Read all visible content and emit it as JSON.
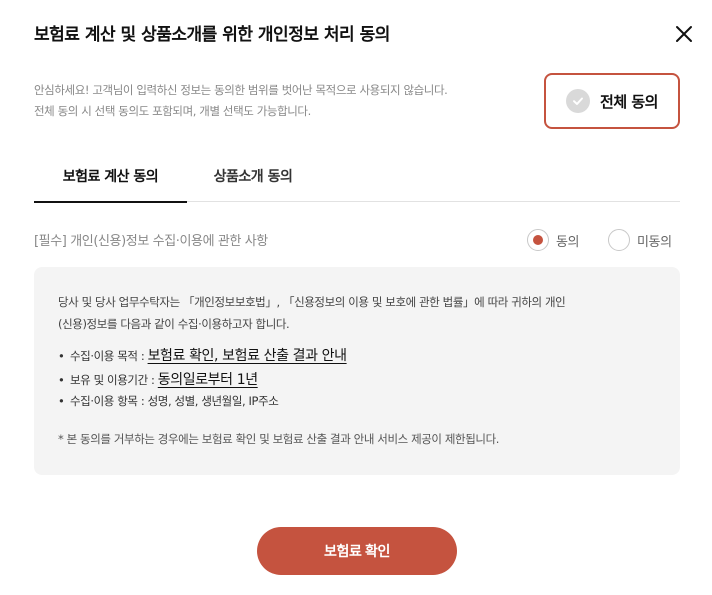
{
  "modal": {
    "title": "보험료 계산 및 상품소개를 위한 개인정보 처리 동의",
    "intro_line1": "안심하세요! 고객님이 입력하신 정보는 동의한 범위를 벗어난 목적으로 사용되지 않습니다.",
    "intro_line2": "전체 동의 시 선택 동의도 포함되며, 개별 선택도 가능합니다.",
    "agree_all_label": "전체 동의"
  },
  "tabs": [
    {
      "label": "보험료 계산 동의",
      "active": true
    },
    {
      "label": "상품소개 동의",
      "active": false
    }
  ],
  "consent": {
    "section_label": "[필수] 개인(신용)정보 수집·이용에 관한 사항",
    "agree_label": "동의",
    "disagree_label": "미동의",
    "selected": "agree"
  },
  "details": {
    "paragraph_line1": "당사 및 당사 업무수탁자는 「개인정보보호법」, 「신용정보의 이용 및 보호에 관한 법률」에 따라 귀하의 개인",
    "paragraph_line2": "(신용)정보를 다음과 같이 수집·이용하고자 합니다.",
    "items": [
      {
        "key": "수집·이용 목적 : ",
        "value": "보험료 확인, 보험료 산출 결과 안내"
      },
      {
        "key": "보유 및 이용기간 : ",
        "value": "동의일로부터 1년"
      },
      {
        "key": "수집·이용 항목 : ",
        "value": "성명, 성별, 생년월일, IP주소"
      }
    ],
    "note": "* 본 동의를 거부하는 경우에는 보험료 확인 및 보험료 산출 결과 안내 서비스 제공이 제한됩니다."
  },
  "footer": {
    "confirm_label": "보험료 확인"
  },
  "colors": {
    "accent": "#c5533f",
    "box_bg": "#f4f4f4"
  }
}
